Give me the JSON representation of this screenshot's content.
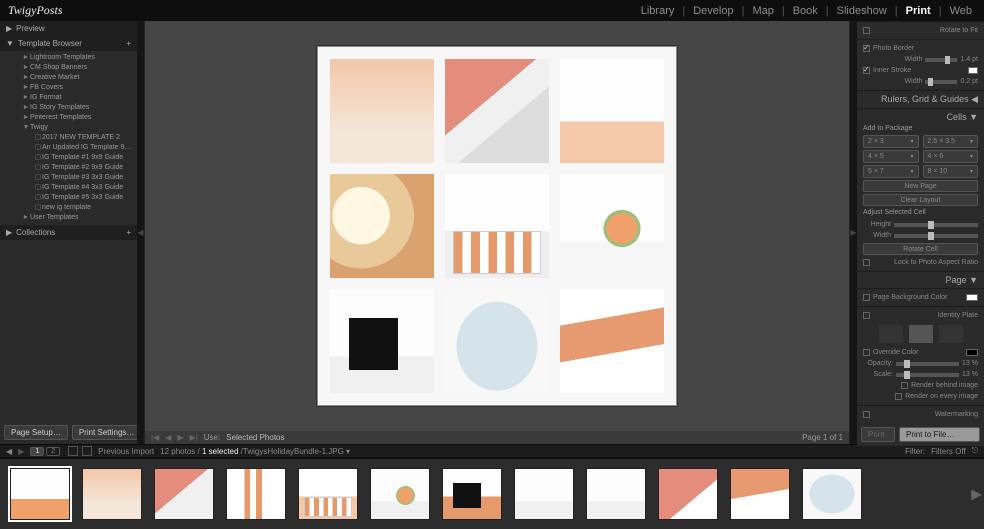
{
  "brand": "TwigyPosts",
  "modules": [
    "Library",
    "Develop",
    "Map",
    "Book",
    "Slideshow",
    "Print",
    "Web"
  ],
  "active_module": "Print",
  "left": {
    "preview": "Preview",
    "template_browser": "Template Browser",
    "plus": "+",
    "tree": [
      {
        "level": 2,
        "tw": "►",
        "label": "Lightroom Templates"
      },
      {
        "level": 2,
        "tw": "►",
        "label": "CM Shop Banners"
      },
      {
        "level": 2,
        "tw": "►",
        "label": "Creative Market"
      },
      {
        "level": 2,
        "tw": "►",
        "label": "FB Covers"
      },
      {
        "level": 2,
        "tw": "►",
        "label": "IG Format"
      },
      {
        "level": 2,
        "tw": "►",
        "label": "IG Story Templates"
      },
      {
        "level": 2,
        "tw": "►",
        "label": "Pinterest Templates"
      },
      {
        "level": 2,
        "tw": "▼",
        "label": "Twigy"
      },
      {
        "level": 3,
        "tw": "▢",
        "label": "2017 NEW TEMPLATE 2"
      },
      {
        "level": 3,
        "tw": "▢",
        "label": "An Updated IG Template 9…"
      },
      {
        "level": 3,
        "tw": "▢",
        "label": "IG Template #1 9x9 Guide"
      },
      {
        "level": 3,
        "tw": "▢",
        "label": "IG Template #2 9x9 Guide"
      },
      {
        "level": 3,
        "tw": "▢",
        "label": "IG Template #3 3x3 Guide"
      },
      {
        "level": 3,
        "tw": "▢",
        "label": "IG Template #4 3x3 Guide"
      },
      {
        "level": 3,
        "tw": "▢",
        "label": "IG Template #5 3x3 Guide"
      },
      {
        "level": 3,
        "tw": "▢",
        "label": "new ig template"
      },
      {
        "level": 2,
        "tw": "►",
        "label": "User Templates"
      }
    ],
    "collections": "Collections",
    "page_setup": "Page Setup…",
    "print_settings": "Print Settings…"
  },
  "stage": {
    "use_label": "Use:",
    "use_value": "Selected Photos",
    "page_count": "Page 1 of 1"
  },
  "right": {
    "rotate_to_fit": "Rotate to Fit",
    "photo_border": "Photo Border",
    "photo_border_width": "Width",
    "photo_border_val": "1.4 pt",
    "inner_stroke": "Inner Stroke",
    "inner_stroke_width": "Width",
    "inner_stroke_val": "0.2 pt",
    "rulers": "Rulers, Grid & Guides",
    "cells_heading": "Cells",
    "add_package": "Add to Package",
    "size_buttons": [
      [
        "2 × 3",
        "2.5 × 3.5"
      ],
      [
        "4 × 5",
        "4 × 6"
      ],
      [
        "5 × 7",
        "8 × 10"
      ]
    ],
    "new_page": "New Page",
    "clear_layout": "Clear Layout",
    "adjust": "Adjust Selected Cell",
    "height_label": "Height",
    "width_label": "Width",
    "rotate_cell": "Rotate Cell",
    "lock_ratio": "Lock to Photo Aspect Ratio",
    "page_heading": "Page",
    "page_bg": "Page Background Color",
    "identity": "Identity Plate",
    "override": "Override Color",
    "opacity": "Opacity:",
    "opacity_val": "13 %",
    "scale": "Scale:",
    "scale_val": "13 %",
    "render_behind": "Render behind image",
    "render_every": "Render on every image",
    "watermark": "Watermarking",
    "print_plain": "Print",
    "print_file": "Print to File…"
  },
  "filter": {
    "page_pills": [
      "1",
      "2"
    ],
    "prev_import": "Previous Import",
    "counts_total": "12 photos",
    "counts_sel": "1 selected",
    "path": "/TwigysHolidayBundle-1.JPG",
    "filter_label": "Filter:",
    "filters_off": "Filters Off"
  }
}
